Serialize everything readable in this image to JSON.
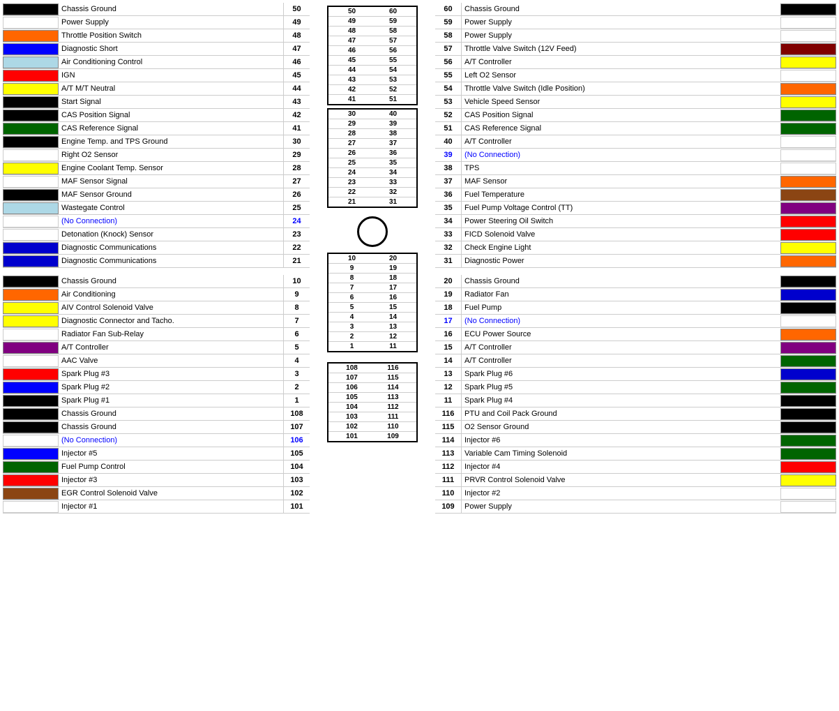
{
  "left": {
    "rows_top": [
      {
        "label": "Chassis Ground",
        "num": "50",
        "color": "#000000",
        "no_conn": false
      },
      {
        "label": "Power Supply",
        "num": "49",
        "color": "",
        "no_conn": false
      },
      {
        "label": "Throttle Position Switch",
        "num": "48",
        "color": "#ff6600",
        "no_conn": false
      },
      {
        "label": "Diagnostic Short",
        "num": "47",
        "color": "#0000ff",
        "no_conn": false
      },
      {
        "label": "Air Conditioning Control",
        "num": "46",
        "color": "#add8e6",
        "no_conn": false
      },
      {
        "label": "IGN",
        "num": "45",
        "color": "#ff0000",
        "no_conn": false
      },
      {
        "label": "A/T M/T Neutral",
        "num": "44",
        "color": "#ffff00",
        "no_conn": false
      },
      {
        "label": "Start Signal",
        "num": "43",
        "color": "#000000",
        "no_conn": false
      },
      {
        "label": "CAS Position Signal",
        "num": "42",
        "color": "#000000",
        "no_conn": false
      },
      {
        "label": "CAS Reference Signal",
        "num": "41",
        "color": "#006400",
        "no_conn": false
      },
      {
        "label": "Engine Temp. and TPS Ground",
        "num": "30",
        "color": "#000000",
        "no_conn": false
      },
      {
        "label": "Right O2 Sensor",
        "num": "29",
        "color": "",
        "no_conn": false
      },
      {
        "label": "Engine Coolant Temp. Sensor",
        "num": "28",
        "color": "#ffff00",
        "no_conn": false
      },
      {
        "label": "MAF Sensor Signal",
        "num": "27",
        "color": "",
        "no_conn": false
      },
      {
        "label": "MAF Sensor Ground",
        "num": "26",
        "color": "#000000",
        "no_conn": false
      },
      {
        "label": "Wastegate Control",
        "num": "25",
        "color": "#add8e6",
        "no_conn": false
      },
      {
        "label": "(No Connection)",
        "num": "24",
        "color": "",
        "no_conn": true
      },
      {
        "label": "Detonation (Knock) Sensor",
        "num": "23",
        "color": "",
        "no_conn": false
      },
      {
        "label": "Diagnostic Communications",
        "num": "22",
        "color": "#0000cd",
        "no_conn": false
      },
      {
        "label": "Diagnostic Communications",
        "num": "21",
        "color": "#0000cd",
        "no_conn": false
      }
    ],
    "rows_bottom": [
      {
        "label": "Chassis Ground",
        "num": "10",
        "color": "#000000",
        "no_conn": false
      },
      {
        "label": "Air Conditioning",
        "num": "9",
        "color": "#ff6600",
        "no_conn": false
      },
      {
        "label": "AIV Control Solenoid Valve",
        "num": "8",
        "color": "#ffff00",
        "no_conn": false
      },
      {
        "label": "Diagnostic Connector and Tacho.",
        "num": "7",
        "color": "#ffff00",
        "no_conn": false
      },
      {
        "label": "Radiator Fan Sub-Relay",
        "num": "6",
        "color": "",
        "no_conn": false
      },
      {
        "label": "A/T Controller",
        "num": "5",
        "color": "#800080",
        "no_conn": false
      },
      {
        "label": "AAC Valve",
        "num": "4",
        "color": "",
        "no_conn": false
      },
      {
        "label": "Spark Plug #3",
        "num": "3",
        "color": "#ff0000",
        "no_conn": false
      },
      {
        "label": "Spark Plug #2",
        "num": "2",
        "color": "#0000ff",
        "no_conn": false
      },
      {
        "label": "Spark Plug #1",
        "num": "1",
        "color": "#000000",
        "no_conn": false
      },
      {
        "label": "Chassis Ground",
        "num": "108",
        "color": "#000000",
        "no_conn": false
      },
      {
        "label": "Chassis Ground",
        "num": "107",
        "color": "#000000",
        "no_conn": false
      },
      {
        "label": "(No Connection)",
        "num": "106",
        "color": "",
        "no_conn": true
      },
      {
        "label": "Injector #5",
        "num": "105",
        "color": "#0000ff",
        "no_conn": false
      },
      {
        "label": "Fuel Pump Control",
        "num": "104",
        "color": "#006400",
        "no_conn": false
      },
      {
        "label": "Injector #3",
        "num": "103",
        "color": "#ff0000",
        "no_conn": false
      },
      {
        "label": "EGR Control Solenoid Valve",
        "num": "102",
        "color": "#8B4513",
        "no_conn": false
      },
      {
        "label": "Injector #1",
        "num": "101",
        "color": "",
        "no_conn": false
      }
    ]
  },
  "right": {
    "rows_top": [
      {
        "label": "Chassis Ground",
        "num": "60",
        "color": "#000000",
        "no_conn": false
      },
      {
        "label": "Power Supply",
        "num": "59",
        "color": "",
        "no_conn": false
      },
      {
        "label": "Power Supply",
        "num": "58",
        "color": "",
        "no_conn": false
      },
      {
        "label": "Throttle Valve Switch (12V Feed)",
        "num": "57",
        "color": "#800000",
        "no_conn": false
      },
      {
        "label": "A/T Controller",
        "num": "56",
        "color": "#ffff00",
        "no_conn": false
      },
      {
        "label": "Left O2 Sensor",
        "num": "55",
        "color": "",
        "no_conn": false
      },
      {
        "label": "Throttle Valve Switch (Idle Position)",
        "num": "54",
        "color": "#ff6600",
        "no_conn": false
      },
      {
        "label": "Vehicle Speed Sensor",
        "num": "53",
        "color": "#ffff00",
        "no_conn": false
      },
      {
        "label": "CAS Position Signal",
        "num": "52",
        "color": "#006400",
        "no_conn": false
      },
      {
        "label": "CAS Reference Signal",
        "num": "51",
        "color": "#006400",
        "no_conn": false
      },
      {
        "label": "A/T Controller",
        "num": "40",
        "color": "",
        "no_conn": false
      },
      {
        "label": "(No Connection)",
        "num": "39",
        "color": "",
        "no_conn": true
      },
      {
        "label": "TPS",
        "num": "38",
        "color": "",
        "no_conn": false
      },
      {
        "label": "MAF Sensor",
        "num": "37",
        "color": "#ff6600",
        "no_conn": false
      },
      {
        "label": "Fuel Temperature",
        "num": "36",
        "color": "#8B4513",
        "no_conn": false
      },
      {
        "label": "Fuel Pump Voltage Control (TT)",
        "num": "35",
        "color": "#800080",
        "no_conn": false
      },
      {
        "label": "Power Steering Oil Switch",
        "num": "34",
        "color": "#ff0000",
        "no_conn": false
      },
      {
        "label": "FICD Solenoid Valve",
        "num": "33",
        "color": "#ff0000",
        "no_conn": false
      },
      {
        "label": "Check Engine Light",
        "num": "32",
        "color": "#ffff00",
        "no_conn": false
      },
      {
        "label": "Diagnostic Power",
        "num": "31",
        "color": "#ff6600",
        "no_conn": false
      }
    ],
    "rows_bottom": [
      {
        "label": "Chassis Ground",
        "num": "20",
        "color": "#000000",
        "no_conn": false
      },
      {
        "label": "Radiator Fan",
        "num": "19",
        "color": "#0000cd",
        "no_conn": false
      },
      {
        "label": "Fuel Pump",
        "num": "18",
        "color": "#000000",
        "no_conn": false
      },
      {
        "label": "(No Connection)",
        "num": "17",
        "color": "",
        "no_conn": true
      },
      {
        "label": "ECU Power Source",
        "num": "16",
        "color": "#ff6600",
        "no_conn": false
      },
      {
        "label": "A/T Controller",
        "num": "15",
        "color": "#800080",
        "no_conn": false
      },
      {
        "label": "A/T Controller",
        "num": "14",
        "color": "#006400",
        "no_conn": false
      },
      {
        "label": "Spark Plug #6",
        "num": "13",
        "color": "#0000cd",
        "no_conn": false
      },
      {
        "label": "Spark Plug #5",
        "num": "12",
        "color": "#006400",
        "no_conn": false
      },
      {
        "label": "Spark Plug #4",
        "num": "11",
        "color": "#000000",
        "no_conn": false
      },
      {
        "label": "PTU and Coil Pack Ground",
        "num": "116",
        "color": "#000000",
        "no_conn": false
      },
      {
        "label": "O2 Sensor Ground",
        "num": "115",
        "color": "#000000",
        "no_conn": false
      },
      {
        "label": "Injector #6",
        "num": "114",
        "color": "#006400",
        "no_conn": false
      },
      {
        "label": "Variable Cam Timing Solenoid",
        "num": "113",
        "color": "#006400",
        "no_conn": false
      },
      {
        "label": "Injector #4",
        "num": "112",
        "color": "#ff0000",
        "no_conn": false
      },
      {
        "label": "PRVR Control Solenoid Valve",
        "num": "111",
        "color": "#ffff00",
        "no_conn": false
      },
      {
        "label": "Injector #2",
        "num": "110",
        "color": "",
        "no_conn": false
      },
      {
        "label": "Power Supply",
        "num": "109",
        "color": "",
        "no_conn": false
      }
    ]
  },
  "connector": {
    "section1": [
      [
        50,
        60
      ],
      [
        49,
        59
      ],
      [
        48,
        58
      ],
      [
        47,
        57
      ],
      [
        46,
        56
      ],
      [
        45,
        55
      ],
      [
        44,
        54
      ],
      [
        43,
        53
      ],
      [
        42,
        52
      ],
      [
        41,
        51
      ]
    ],
    "section2": [
      [
        30,
        40
      ],
      [
        29,
        39
      ],
      [
        28,
        38
      ],
      [
        27,
        37
      ],
      [
        26,
        36
      ],
      [
        25,
        35
      ],
      [
        24,
        34
      ],
      [
        23,
        33
      ],
      [
        22,
        32
      ],
      [
        21,
        31
      ]
    ],
    "section3": [
      [
        10,
        20
      ],
      [
        9,
        19
      ],
      [
        8,
        18
      ],
      [
        7,
        17
      ],
      [
        6,
        16
      ],
      [
        5,
        15
      ],
      [
        4,
        14
      ],
      [
        3,
        13
      ],
      [
        2,
        12
      ],
      [
        1,
        11
      ]
    ],
    "section4": [
      [
        108,
        116
      ],
      [
        107,
        115
      ],
      [
        106,
        114
      ],
      [
        105,
        113
      ],
      [
        104,
        112
      ],
      [
        103,
        111
      ],
      [
        102,
        110
      ],
      [
        101,
        109
      ]
    ]
  }
}
